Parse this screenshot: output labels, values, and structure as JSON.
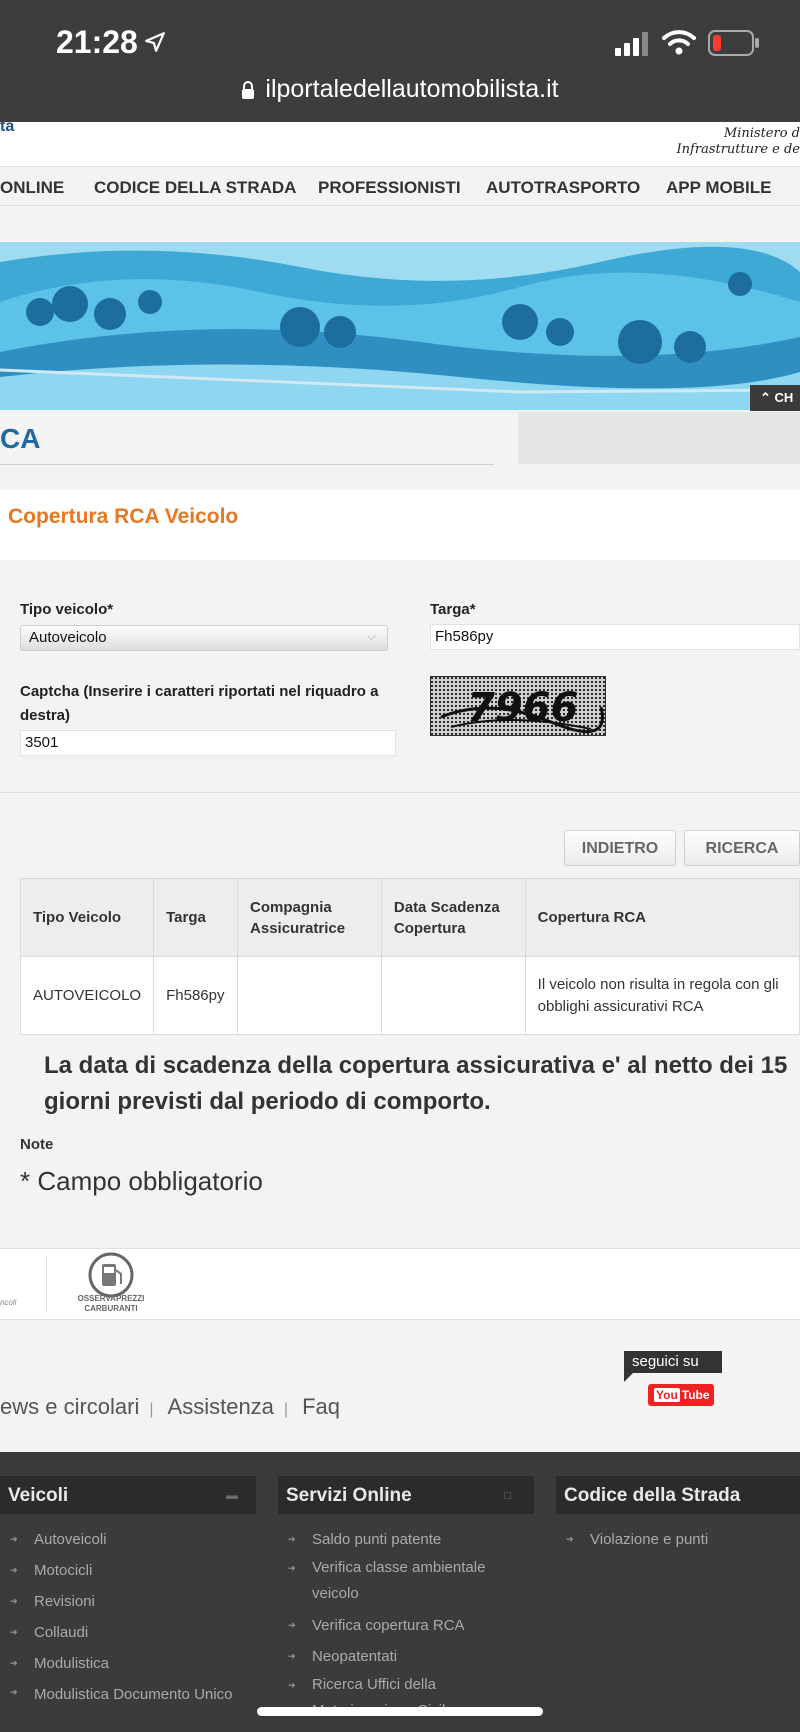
{
  "status_bar": {
    "time": "21:28",
    "url": "ilportaledellautomobilista.it"
  },
  "header": {
    "logo_fragment": "ta",
    "ministry_line1": "Ministero d",
    "ministry_line2": "Infrastrutture e de",
    "nav": [
      "ONLINE",
      "CODICE DELLA STRADA",
      "PROFESSIONISTI",
      "AUTOTRASPORTO",
      "APP MOBILE"
    ],
    "banner_button": "CH"
  },
  "page": {
    "ca_title": "CA",
    "section_title": "Copertura RCA Veicolo"
  },
  "form": {
    "tipo_label": "Tipo veicolo*",
    "tipo_value": "Autoveicolo",
    "targa_label": "Targa*",
    "targa_value": "Fh586py",
    "captcha_label": "Captcha (Inserire i caratteri riportati nel riquadro a destra)",
    "captcha_value": "3501",
    "captcha_image_text": "7966"
  },
  "buttons": {
    "back": "INDIETRO",
    "search": "RICERCA"
  },
  "table": {
    "headers": [
      "Tipo Veicolo",
      "Targa",
      "Compagnia Assicuratrice",
      "Data Scadenza Copertura",
      "Copertura RCA"
    ],
    "row": [
      "AUTOVEICOLO",
      "Fh586py",
      "",
      "",
      "Il veicolo non risulta in regola con gli obblighi assicurativi RCA"
    ]
  },
  "notice": "La data di scadenza della copertura assicurativa e' al netto dei 15 giorni previsti dal periodo di comporto.",
  "note_label": "Note",
  "required_note": "* Campo obbligatorio",
  "partners": {
    "left_fragment": "ncoli",
    "osserv_line1": "OSSERVAPREZZI",
    "osserv_line2": "CARBURANTI"
  },
  "social": {
    "follow": "seguici su",
    "yt_you": "You",
    "yt_tube": "Tube"
  },
  "footer_links": [
    "ews e circolari",
    "Assistenza",
    "Faq"
  ],
  "footer_cols": [
    {
      "title": "Veicoli",
      "items": [
        "Autoveicoli",
        "Motocicli",
        "Revisioni",
        "Collaudi",
        "Modulistica",
        "Modulistica Documento Unico"
      ]
    },
    {
      "title": "Servizi Online",
      "items": [
        "Saldo punti patente",
        "Verifica classe ambientale veicolo",
        "Verifica copertura RCA",
        "Neopatentati",
        "Ricerca Uffici della Motorizzazione Civile"
      ]
    },
    {
      "title": "Codice della Strada",
      "items": [
        "Violazione e punti"
      ]
    }
  ],
  "colors": {
    "accent_orange": "#e87722",
    "title_blue": "#1f6aa0",
    "footer_dark": "#3b3b3b"
  }
}
